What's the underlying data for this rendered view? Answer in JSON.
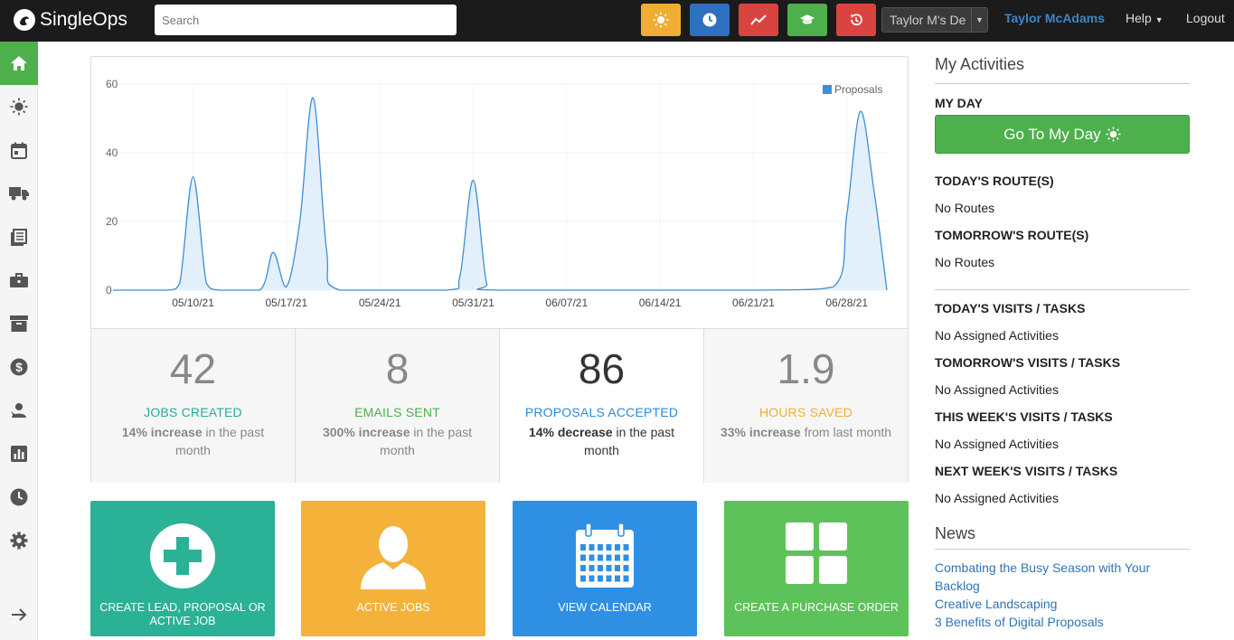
{
  "app": {
    "name": "SingleOps"
  },
  "search": {
    "placeholder": "Search"
  },
  "header": {
    "quick_buttons": [
      {
        "icon": "sun-icon",
        "color": "#f0ad33"
      },
      {
        "icon": "clock-icon",
        "color": "#2f6fbf"
      },
      {
        "icon": "trend-icon",
        "color": "#d9443f"
      },
      {
        "icon": "graduation-cap-icon",
        "color": "#4db04d"
      },
      {
        "icon": "history-icon",
        "color": "#d9443f"
      }
    ],
    "account_select": "Taylor M's De",
    "user_name": "Taylor McAdams",
    "help_label": "Help",
    "logout_label": "Logout"
  },
  "sidebar": {
    "items": [
      "home-icon",
      "sun-icon",
      "calendar-icon",
      "truck-icon",
      "book-icon",
      "briefcase-icon",
      "archive-icon",
      "dollar-icon",
      "users-icon",
      "bar-chart-icon",
      "clock-icon",
      "gear-icon",
      "arrow-right-icon"
    ]
  },
  "chart_data": {
    "type": "area",
    "series": [
      {
        "name": "Proposals",
        "color": "#3d8fd6"
      }
    ],
    "x_ticks": [
      "05/10/21",
      "05/17/21",
      "05/24/21",
      "05/31/21",
      "06/07/21",
      "06/14/21",
      "06/21/21",
      "06/28/21"
    ],
    "ylim": [
      0,
      60
    ],
    "y_ticks": [
      0,
      20,
      40,
      60
    ],
    "points": [
      {
        "x": "05/04/21",
        "y": 0
      },
      {
        "x": "05/08/21",
        "y": 0
      },
      {
        "x": "05/09/21",
        "y": 2
      },
      {
        "x": "05/10/21",
        "y": 33
      },
      {
        "x": "05/11/21",
        "y": 2
      },
      {
        "x": "05/12/21",
        "y": 0
      },
      {
        "x": "05/15/21",
        "y": 0
      },
      {
        "x": "05/16/21",
        "y": 11
      },
      {
        "x": "05/17/21",
        "y": 1
      },
      {
        "x": "05/18/21",
        "y": 20
      },
      {
        "x": "05/19/21",
        "y": 56
      },
      {
        "x": "05/20/21",
        "y": 12
      },
      {
        "x": "05/21/21",
        "y": 0
      },
      {
        "x": "05/29/21",
        "y": 0
      },
      {
        "x": "05/30/21",
        "y": 4
      },
      {
        "x": "05/31/21",
        "y": 32
      },
      {
        "x": "06/01/21",
        "y": 2
      },
      {
        "x": "06/02/21",
        "y": 0
      },
      {
        "x": "06/21/21",
        "y": 0
      },
      {
        "x": "06/27/21",
        "y": 1
      },
      {
        "x": "06/28/21",
        "y": 22
      },
      {
        "x": "06/29/21",
        "y": 52
      },
      {
        "x": "06/30/21",
        "y": 30
      },
      {
        "x": "07/01/21",
        "y": 0
      }
    ],
    "legend": "top-right",
    "grid": true
  },
  "stats": [
    {
      "value": "42",
      "label": "JOBS CREATED",
      "change": "14% increase",
      "suffix": "in the past month",
      "color": "#27ab97"
    },
    {
      "value": "8",
      "label": "EMAILS SENT",
      "change": "300% increase",
      "suffix": "in the past month",
      "color": "#4db04d"
    },
    {
      "value": "86",
      "label": "PROPOSALS ACCEPTED",
      "change": "14% decrease",
      "suffix": "in the past month",
      "color": "#2f88d8"
    },
    {
      "value": "1.9",
      "label": "HOURS SAVED",
      "change": "33% increase",
      "suffix": "from last month",
      "color": "#f0ad33"
    }
  ],
  "tiles": [
    {
      "label": "CREATE LEAD, PROPOSAL OR ACTIVE JOB",
      "color": "#2bb196",
      "icon": "plus-circle-icon"
    },
    {
      "label": "ACTIVE JOBS",
      "color": "#f4b23a",
      "icon": "person-icon"
    },
    {
      "label": "VIEW CALENDAR",
      "color": "#2f8fe3",
      "icon": "calendar-icon"
    },
    {
      "label": "CREATE A PURCHASE ORDER",
      "color": "#5dc25a",
      "icon": "grid-icon"
    }
  ],
  "activities": {
    "title": "My Activities",
    "my_day": "MY DAY",
    "go_button": "Go To My Day",
    "todays_routes": "TODAY'S ROUTE(S)",
    "no_routes_1": "No Routes",
    "tomorrows_routes": "TOMORROW'S ROUTE(S)",
    "no_routes_2": "No Routes",
    "todays_visits": "TODAY'S VISITS / TASKS",
    "none_1": "No Assigned Activities",
    "tomorrows_visits": "TOMORROW'S VISITS / TASKS",
    "none_2": "No Assigned Activities",
    "week_visits": "THIS WEEK'S VISITS / TASKS",
    "none_3": "No Assigned Activities",
    "next_week_visits": "NEXT WEEK'S VISITS / TASKS",
    "none_4": "No Assigned Activities"
  },
  "news": {
    "title": "News",
    "items": [
      "Combating the Busy Season with Your Backlog",
      "Creative Landscaping",
      "3 Benefits of Digital Proposals"
    ]
  }
}
